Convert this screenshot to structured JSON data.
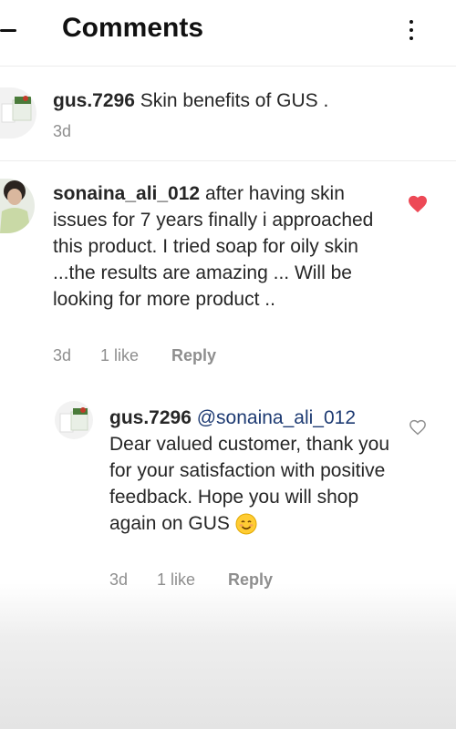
{
  "header": {
    "title": "Comments"
  },
  "caption": {
    "username": "gus.7296",
    "text": "Skin benefits of GUS .",
    "time": "3d"
  },
  "comment": {
    "username": "sonaina_ali_012",
    "text": "after having skin issues for 7 years finally i approached this product.  I tried soap for oily skin ...the results are amazing ... Will be looking  for more product ..",
    "time": "3d",
    "likes": "1 like",
    "reply_label": "Reply",
    "liked": true
  },
  "reply": {
    "username": "gus.7296",
    "mention": "@sonaina_ali_012",
    "text": "Dear valued customer, thank you for your satisfaction with positive feedback. Hope you will shop again on GUS",
    "emoji": "smiling-face-emoji",
    "time": "3d",
    "likes": "1 like",
    "reply_label": "Reply",
    "liked": false
  },
  "colors": {
    "heart_liked": "#ed4956",
    "meta_gray": "#8e8e8e",
    "mention": "#1d3a72"
  }
}
